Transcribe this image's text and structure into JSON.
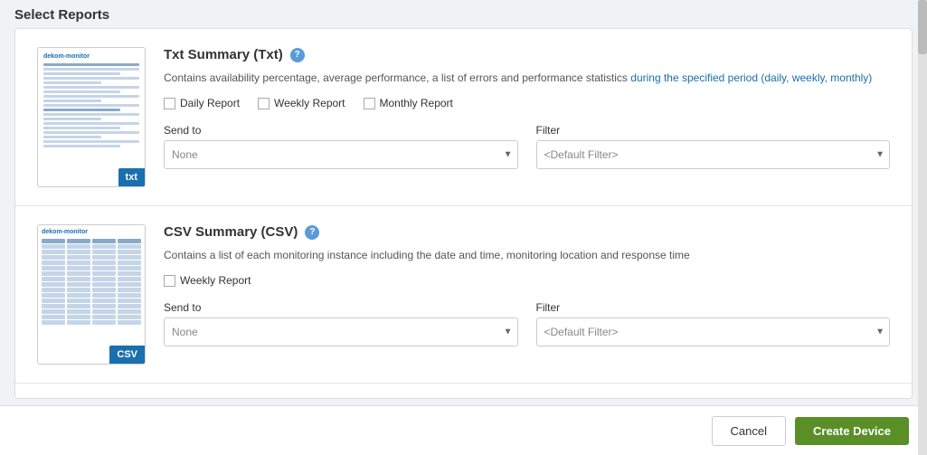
{
  "page": {
    "title": "Select Reports"
  },
  "reports": [
    {
      "id": "txt",
      "title": "Txt Summary (Txt)",
      "badge": "txt",
      "description": "Contains availability percentage, average performance, a list of errors and performance statistics during the specified period (daily, weekly, monthly)",
      "checkboxes": [
        {
          "label": "Daily Report",
          "checked": false
        },
        {
          "label": "Weekly Report",
          "checked": false
        },
        {
          "label": "Monthly Report",
          "checked": false
        }
      ],
      "send_to_label": "Send to",
      "send_to_placeholder": "None",
      "filter_label": "Filter",
      "filter_placeholder": "<Default Filter>"
    },
    {
      "id": "csv",
      "title": "CSV Summary (CSV)",
      "badge": "CSV",
      "description": "Contains a list of each monitoring instance including the date and time, monitoring location and response time",
      "checkboxes": [
        {
          "label": "Weekly Report",
          "checked": false
        }
      ],
      "send_to_label": "Send to",
      "send_to_placeholder": "None",
      "filter_label": "Filter",
      "filter_placeholder": "<Default Filter>"
    }
  ],
  "footer": {
    "cancel_label": "Cancel",
    "create_label": "Create Device"
  }
}
